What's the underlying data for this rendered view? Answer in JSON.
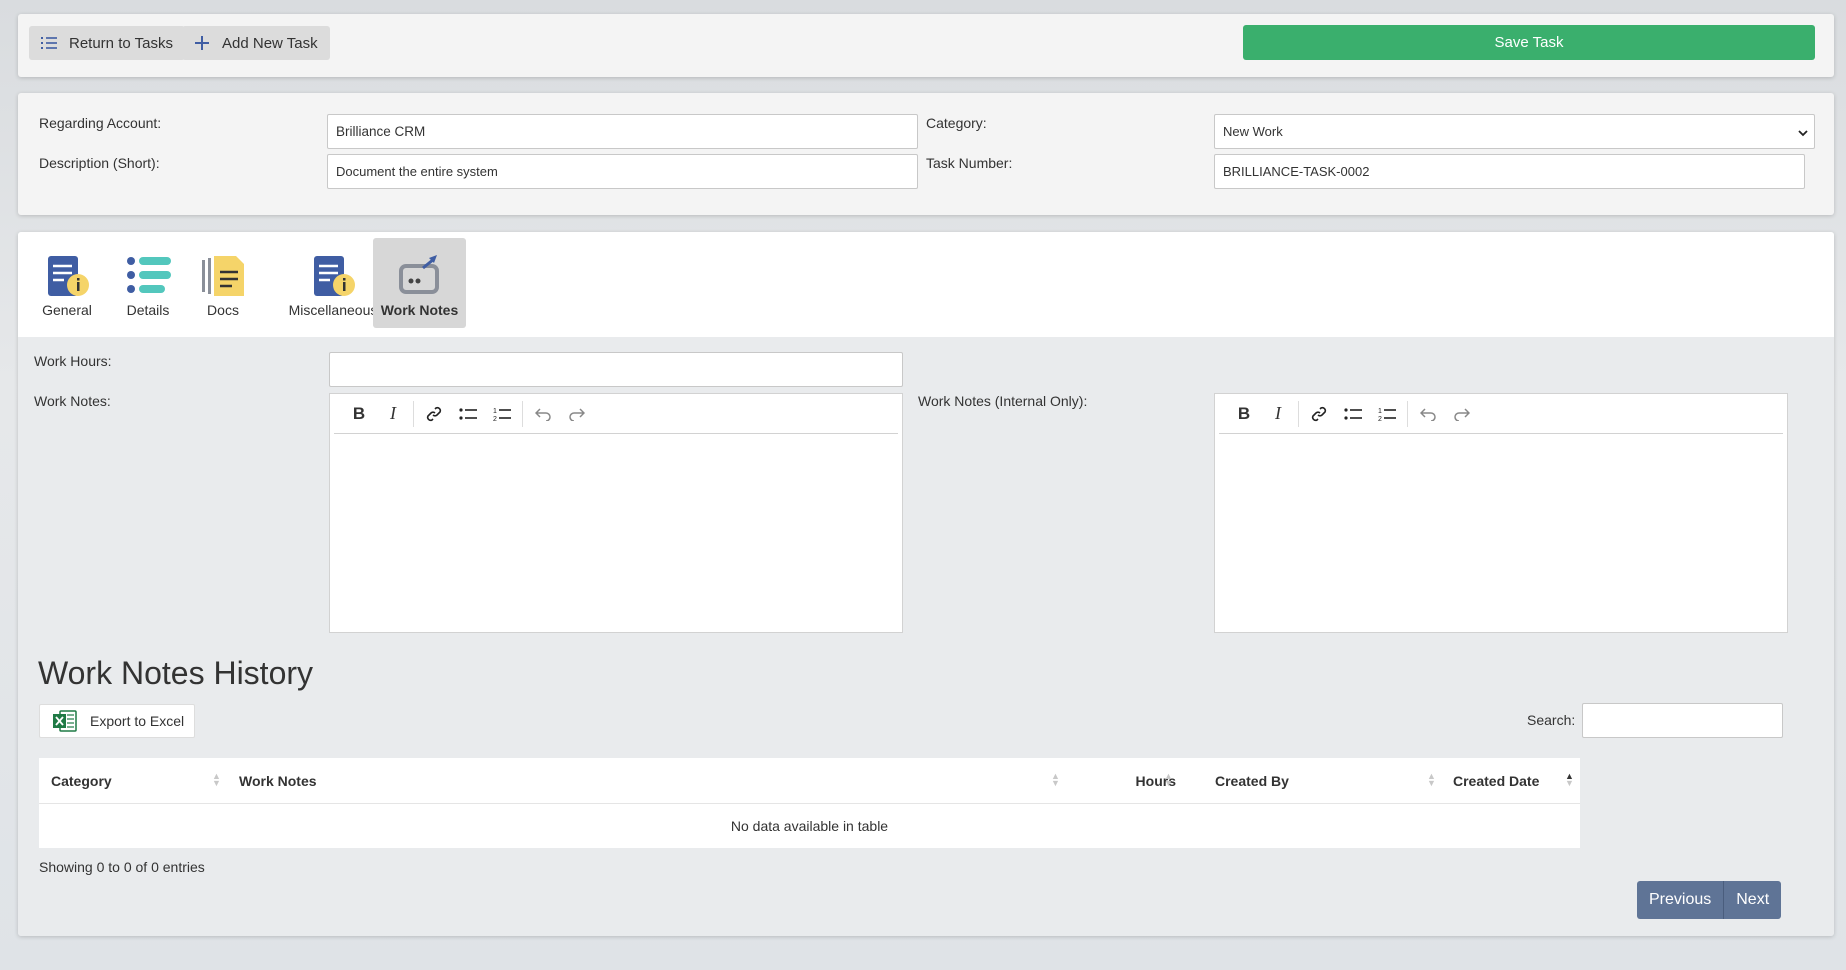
{
  "toolbar": {
    "return_label": "Return to Tasks",
    "add_label": "Add New Task",
    "save_label": "Save Task"
  },
  "header": {
    "account_label": "Regarding Account:",
    "account_value": "Brilliance CRM",
    "desc_label": "Description (Short):",
    "desc_value": "Document the entire system",
    "category_label": "Category:",
    "category_value": "New Work",
    "number_label": "Task Number:",
    "number_value": "BRILLIANCE-TASK-0002"
  },
  "tabs": [
    {
      "label": "General",
      "icon": "document-info-icon"
    },
    {
      "label": "Details",
      "icon": "list-icon"
    },
    {
      "label": "Docs",
      "icon": "docs-icon"
    },
    {
      "label": "Miscellaneous",
      "icon": "document-info-icon"
    },
    {
      "label": "Work Notes",
      "icon": "work-notes-icon",
      "active": true
    }
  ],
  "form": {
    "hours_label": "Work Hours:",
    "notes_label": "Work Notes:",
    "internal_label": "Work Notes (Internal Only):"
  },
  "history": {
    "title": "Work Notes History",
    "export_label": "Export to Excel",
    "search_label": "Search:",
    "columns": [
      "Category",
      "Work Notes",
      "Hours",
      "Created By",
      "Created Date"
    ],
    "empty_text": "No data available in table",
    "info": "Showing 0 to 0 of 0 entries",
    "prev_label": "Previous",
    "next_label": "Next"
  },
  "colors": {
    "save": "#3aaf6d",
    "pager": "#5f7496",
    "icon_blue": "#3f5da3",
    "icon_teal": "#53c7bd",
    "icon_yellow": "#f5d469"
  }
}
